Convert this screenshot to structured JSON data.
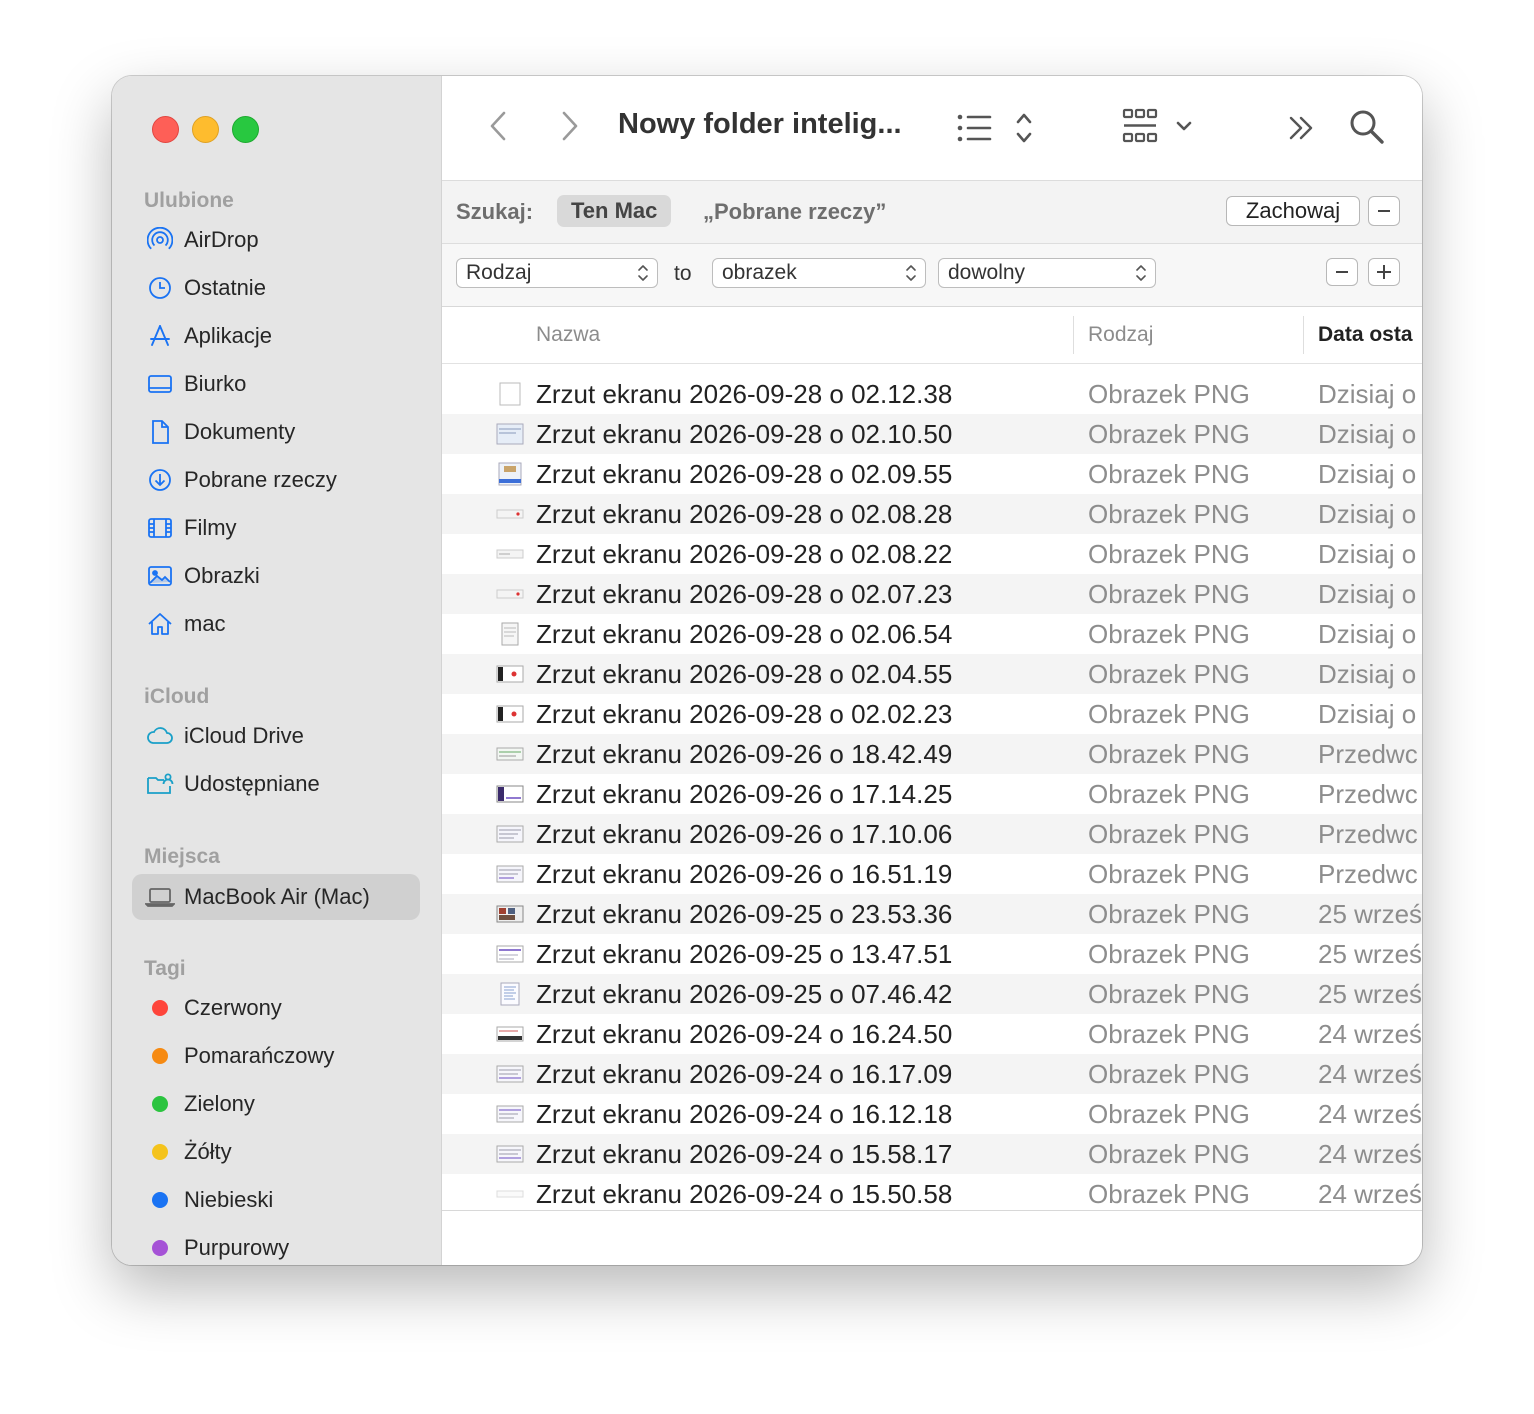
{
  "sidebar": {
    "sections": {
      "favorites": "Ulubione",
      "icloud": "iCloud",
      "locations": "Miejsca",
      "tags": "Tagi"
    },
    "favorites": [
      {
        "label": "AirDrop",
        "icon": "airdrop-icon"
      },
      {
        "label": "Ostatnie",
        "icon": "clock-icon"
      },
      {
        "label": "Aplikacje",
        "icon": "applications-icon"
      },
      {
        "label": "Biurko",
        "icon": "desktop-icon"
      },
      {
        "label": "Dokumenty",
        "icon": "document-icon"
      },
      {
        "label": "Pobrane rzeczy",
        "icon": "download-icon"
      },
      {
        "label": "Filmy",
        "icon": "film-icon"
      },
      {
        "label": "Obrazki",
        "icon": "photo-icon"
      },
      {
        "label": "mac",
        "icon": "home-icon"
      }
    ],
    "icloud": [
      {
        "label": "iCloud Drive",
        "icon": "cloud-icon"
      },
      {
        "label": "Udostępniane",
        "icon": "shared-folder-icon"
      }
    ],
    "locations": [
      {
        "label": "MacBook Air (Mac)",
        "icon": "laptop-icon"
      }
    ],
    "tags": [
      {
        "label": "Czerwony",
        "color": "#fe453b"
      },
      {
        "label": "Pomarańczowy",
        "color": "#f68a12"
      },
      {
        "label": "Zielony",
        "color": "#2bc43f"
      },
      {
        "label": "Żółty",
        "color": "#f4c31c"
      },
      {
        "label": "Niebieski",
        "color": "#1a73f3"
      },
      {
        "label": "Purpurowy",
        "color": "#a552d6"
      }
    ]
  },
  "toolbar": {
    "title": "Nowy folder intelig..."
  },
  "search": {
    "label": "Szukaj:",
    "scope_selected": "Ten Mac",
    "scope_other": "„Pobrane rzeczy”",
    "save_label": "Zachowaj"
  },
  "criteria": {
    "attribute": "Rodzaj",
    "connector": "to",
    "value": "obrazek",
    "qualifier": "dowolny"
  },
  "columns": {
    "name": "Nazwa",
    "kind": "Rodzaj",
    "date": "Data osta"
  },
  "rows": [
    {
      "name": "Zrzut ekranu 2026-09-28 o 02.12.38",
      "kind": "Obrazek PNG",
      "date": "Dzisiaj o"
    },
    {
      "name": "Zrzut ekranu 2026-09-28 o 02.10.50",
      "kind": "Obrazek PNG",
      "date": "Dzisiaj o"
    },
    {
      "name": "Zrzut ekranu 2026-09-28 o 02.09.55",
      "kind": "Obrazek PNG",
      "date": "Dzisiaj o"
    },
    {
      "name": "Zrzut ekranu 2026-09-28 o 02.08.28",
      "kind": "Obrazek PNG",
      "date": "Dzisiaj o"
    },
    {
      "name": "Zrzut ekranu 2026-09-28 o 02.08.22",
      "kind": "Obrazek PNG",
      "date": "Dzisiaj o"
    },
    {
      "name": "Zrzut ekranu 2026-09-28 o 02.07.23",
      "kind": "Obrazek PNG",
      "date": "Dzisiaj o"
    },
    {
      "name": "Zrzut ekranu 2026-09-28 o 02.06.54",
      "kind": "Obrazek PNG",
      "date": "Dzisiaj o"
    },
    {
      "name": "Zrzut ekranu 2026-09-28 o 02.04.55",
      "kind": "Obrazek PNG",
      "date": "Dzisiaj o"
    },
    {
      "name": "Zrzut ekranu 2026-09-28 o 02.02.23",
      "kind": "Obrazek PNG",
      "date": "Dzisiaj o"
    },
    {
      "name": "Zrzut ekranu 2026-09-26 o 18.42.49",
      "kind": "Obrazek PNG",
      "date": "Przedwc"
    },
    {
      "name": "Zrzut ekranu 2026-09-26 o 17.14.25",
      "kind": "Obrazek PNG",
      "date": "Przedwc"
    },
    {
      "name": "Zrzut ekranu 2026-09-26 o 17.10.06",
      "kind": "Obrazek PNG",
      "date": "Przedwc"
    },
    {
      "name": "Zrzut ekranu 2026-09-26 o 16.51.19",
      "kind": "Obrazek PNG",
      "date": "Przedwc"
    },
    {
      "name": "Zrzut ekranu 2026-09-25 o 23.53.36",
      "kind": "Obrazek PNG",
      "date": "25 wrześ"
    },
    {
      "name": "Zrzut ekranu 2026-09-25 o 13.47.51",
      "kind": "Obrazek PNG",
      "date": "25 wrześ"
    },
    {
      "name": "Zrzut ekranu 2026-09-25 o 07.46.42",
      "kind": "Obrazek PNG",
      "date": "25 wrześ"
    },
    {
      "name": "Zrzut ekranu 2026-09-24 o 16.24.50",
      "kind": "Obrazek PNG",
      "date": "24 wrześ"
    },
    {
      "name": "Zrzut ekranu 2026-09-24 o 16.17.09",
      "kind": "Obrazek PNG",
      "date": "24 wrześ"
    },
    {
      "name": "Zrzut ekranu 2026-09-24 o 16.12.18",
      "kind": "Obrazek PNG",
      "date": "24 wrześ"
    },
    {
      "name": "Zrzut ekranu 2026-09-24 o 15.58.17",
      "kind": "Obrazek PNG",
      "date": "24 wrześ"
    },
    {
      "name": "Zrzut ekranu 2026-09-24 o 15.50.58",
      "kind": "Obrazek PNG",
      "date": "24 wrześ"
    }
  ],
  "colors": {
    "accent": "#1a73f3",
    "sidebar_bg": "#e5e5e5",
    "selection": "#d0d0d0"
  }
}
